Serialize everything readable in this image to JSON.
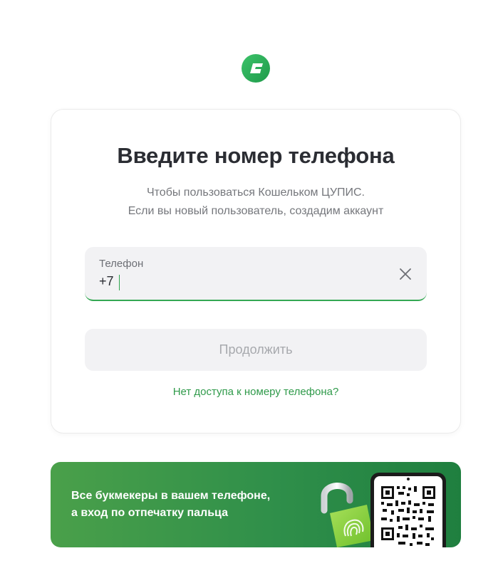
{
  "brand": {
    "logo_icon": "wallet-logo-icon",
    "accent_color": "#34a853"
  },
  "auth_card": {
    "title": "Введите номер телефона",
    "subtitle_line1": "Чтобы пользоваться Кошельком ЦУПИС.",
    "subtitle_line2": "Если вы новый пользователь, создадим аккаунт",
    "phone_field": {
      "label": "Телефон",
      "value": "+7",
      "clear_icon": "close-icon"
    },
    "continue_label": "Продолжить",
    "no_access_link": "Нет доступа к номеру телефона?"
  },
  "promo_banner": {
    "line1": "Все букмекеры в вашем телефоне,",
    "line2": "а вход по отпечатку пальца",
    "lock_icon": "fingerprint-lock-icon",
    "qr_icon": "qr-code-icon"
  }
}
